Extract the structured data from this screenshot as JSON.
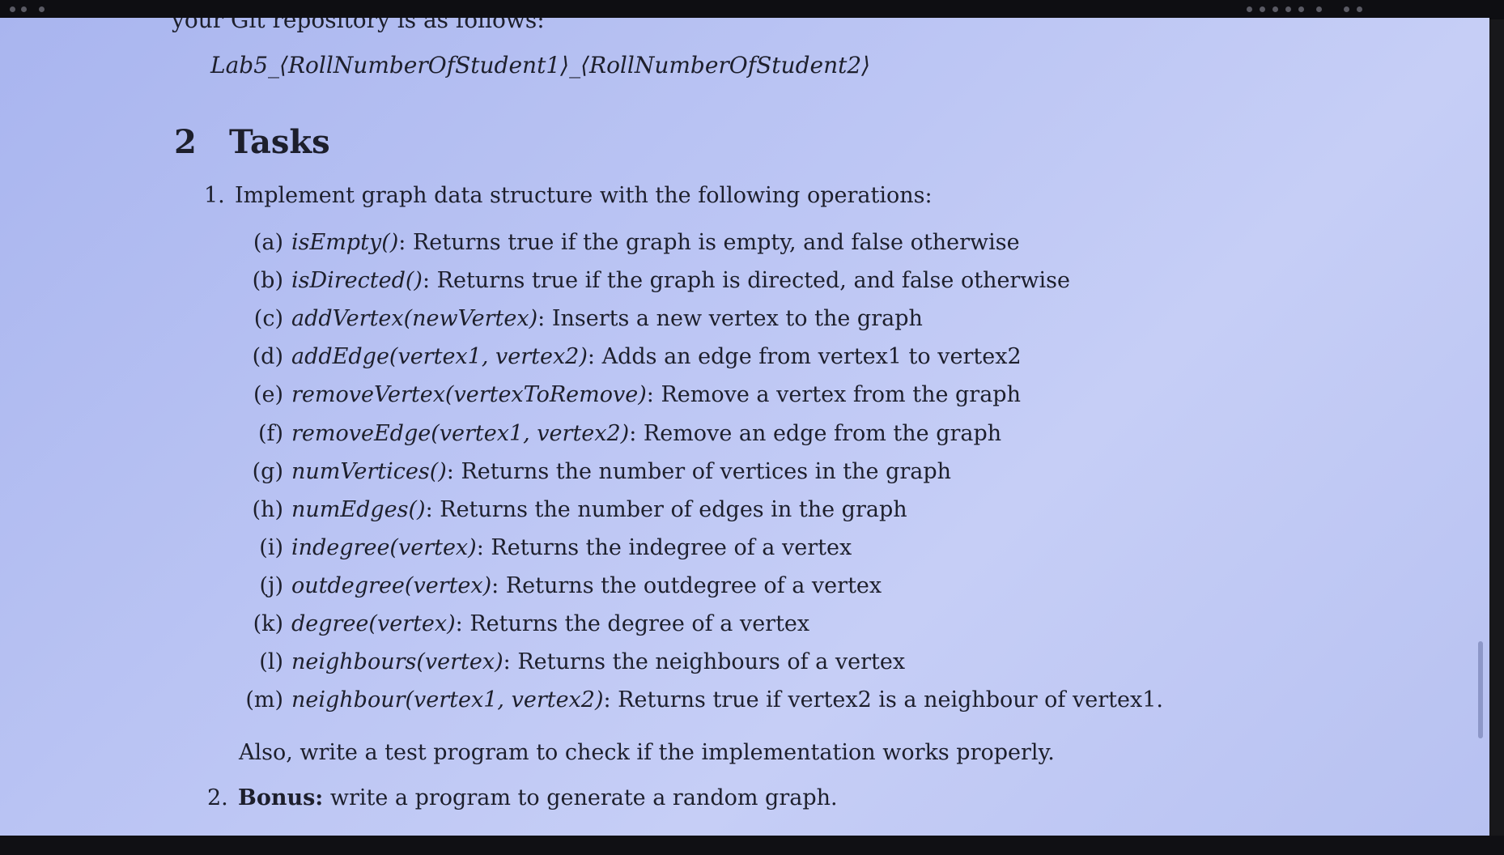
{
  "document": {
    "cut_line": "your Git repository is as follows:",
    "repo_name": "Lab5_⟨RollNumberOfStudent1⟩_⟨RollNumberOfStudent2⟩",
    "section": {
      "number": "2",
      "title": "Tasks"
    },
    "task1": {
      "number": "1.",
      "text": "Implement graph data structure with the following operations:"
    },
    "operations": [
      {
        "letter": "(a)",
        "fn": "isEmpty()",
        "desc": ": Returns true if the graph is empty, and false otherwise"
      },
      {
        "letter": "(b)",
        "fn": "isDirected()",
        "desc": ": Returns true if the graph is directed, and false otherwise"
      },
      {
        "letter": "(c)",
        "fn": "addVertex(newVertex)",
        "desc": ": Inserts a new vertex to the graph"
      },
      {
        "letter": "(d)",
        "fn": "addEdge(vertex1, vertex2)",
        "desc": ": Adds an edge from vertex1 to vertex2"
      },
      {
        "letter": "(e)",
        "fn": "removeVertex(vertexToRemove)",
        "desc": ": Remove a vertex from the graph"
      },
      {
        "letter": "(f)",
        "fn": "removeEdge(vertex1, vertex2)",
        "desc": ": Remove an edge from the graph"
      },
      {
        "letter": "(g)",
        "fn": "numVertices()",
        "desc": ": Returns the number of vertices in the graph"
      },
      {
        "letter": "(h)",
        "fn": "numEdges()",
        "desc": ": Returns the number of edges in the graph"
      },
      {
        "letter": "(i)",
        "fn": "indegree(vertex)",
        "desc": ": Returns the indegree of a vertex"
      },
      {
        "letter": "(j)",
        "fn": "outdegree(vertex)",
        "desc": ": Returns the outdegree of a vertex"
      },
      {
        "letter": "(k)",
        "fn": "degree(vertex)",
        "desc": ": Returns the degree of a vertex"
      },
      {
        "letter": "(l)",
        "fn": "neighbours(vertex)",
        "desc": ": Returns the neighbours of a vertex"
      },
      {
        "letter": "(m)",
        "fn": "neighbour(vertex1, vertex2)",
        "desc": ": Returns true if vertex2 is a neighbour of vertex1."
      }
    ],
    "also_text": "Also, write a test program to check if the implementation works properly.",
    "task2": {
      "number": "2.",
      "bold": "Bonus:",
      "text": " write a program to generate a random graph."
    }
  }
}
